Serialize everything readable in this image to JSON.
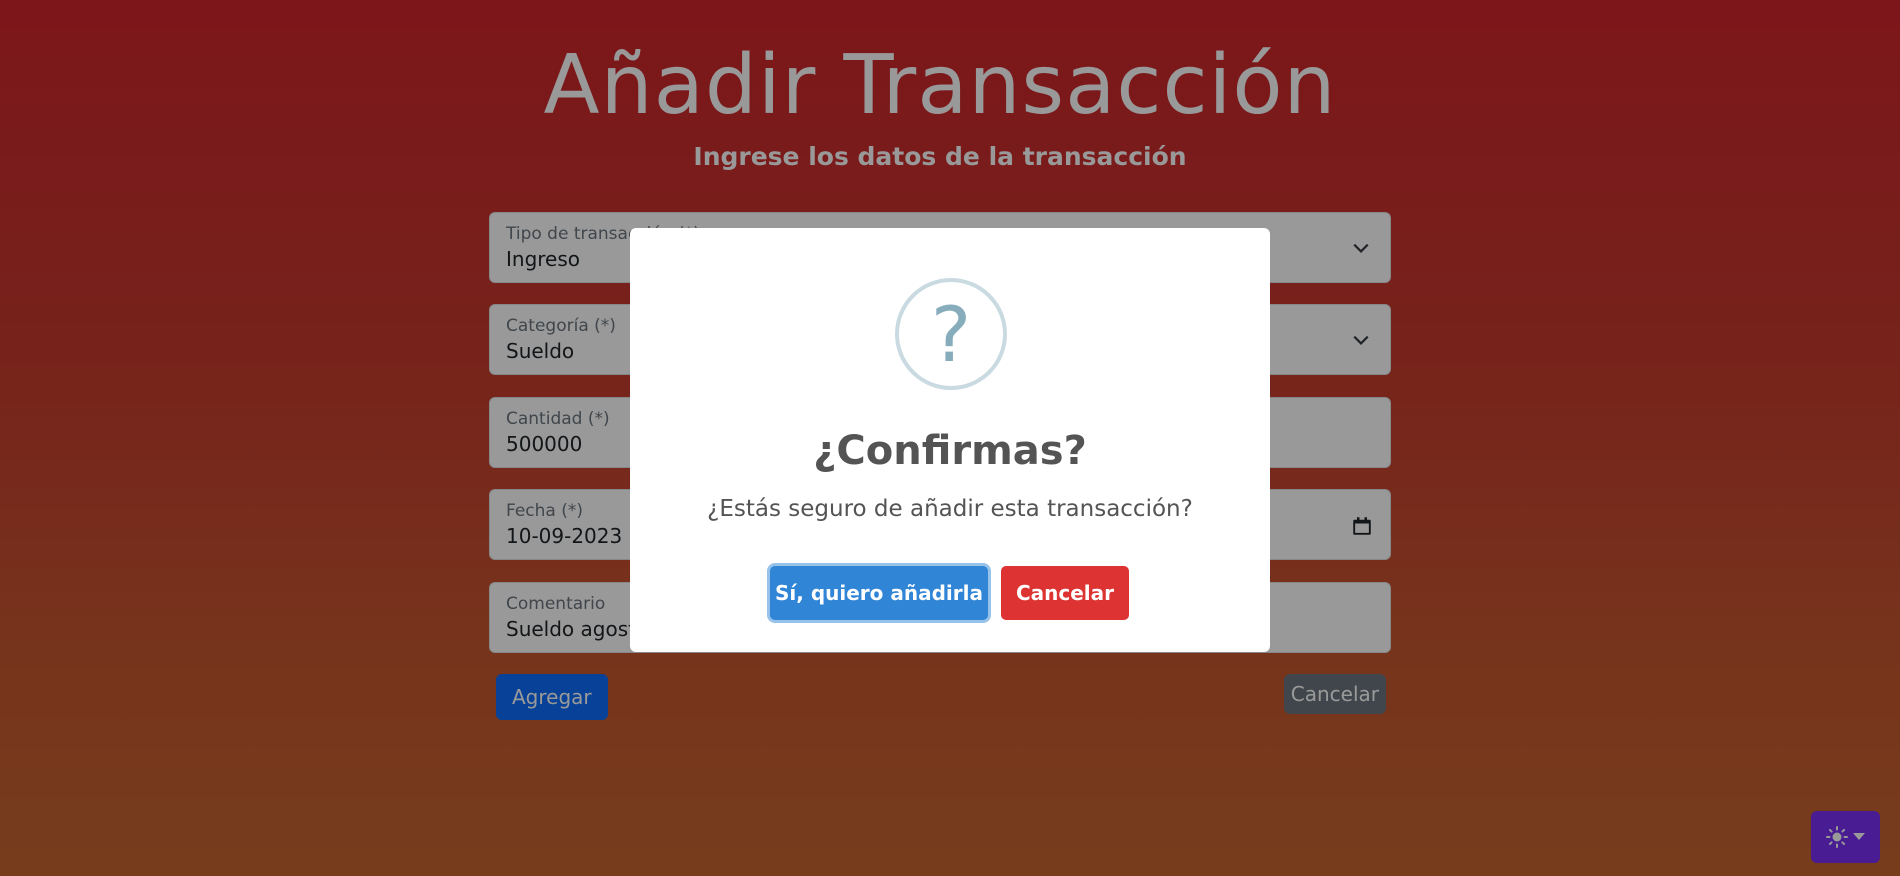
{
  "page": {
    "title": "Añadir Transacción",
    "subtitle": "Ingrese los datos de la transacción"
  },
  "form": {
    "fields": [
      {
        "label": "Tipo de transacción (*)",
        "value": "Ingreso",
        "type": "select"
      },
      {
        "label": "Categoría (*)",
        "value": "Sueldo",
        "type": "select"
      },
      {
        "label": "Cantidad (*)",
        "value": "500000",
        "type": "number"
      },
      {
        "label": "Fecha (*)",
        "value": "10-09-2023",
        "type": "date"
      },
      {
        "label": "Comentario",
        "value": "Sueldo agosto",
        "type": "text"
      }
    ],
    "add_button": "Agregar",
    "cancel_button": "Cancelar"
  },
  "modal": {
    "icon": "?",
    "title": "¿Confirmas?",
    "text": "¿Estás seguro de añadir esta transacción?",
    "confirm_button": "Sí, quiero añadirla",
    "cancel_button": "Cancelar"
  },
  "theme_toggle": {
    "icon": "sun-icon"
  },
  "colors": {
    "primary": "#0d6efd",
    "confirm": "#3085d6",
    "danger": "#dd3333",
    "theme_button": "#7a2ff7"
  }
}
